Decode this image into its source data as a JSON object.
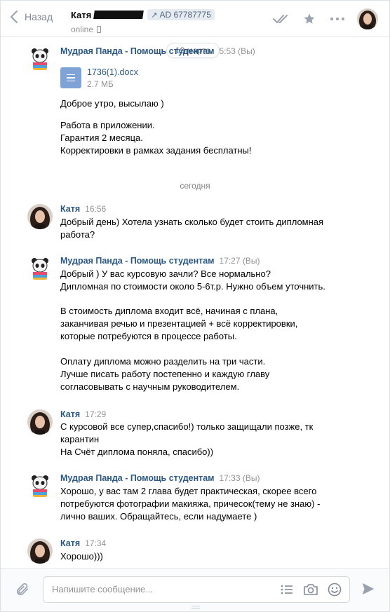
{
  "header": {
    "back_label": "Назад",
    "peer_name": "Катя",
    "ad_label": "AD 67787775",
    "status": "online"
  },
  "history": {
    "date_pill": "19 марта",
    "separator_today": "сегодня",
    "messages": [
      {
        "author": "Мудрая Панда - Помощь студентам",
        "time": "5:53 (Вы)",
        "doc_name": "1736(1).docx",
        "doc_size": "2.7 МБ",
        "text": "Доброе утро, высылаю )",
        "text2": "Работа в приложении.\nГарантия 2 месяца.\nКорректировки в рамках задания бесплатны!"
      },
      {
        "author": "Катя",
        "time": "16:56",
        "text": "Добрый день) Хотела узнать сколько будет стоить дипломная\nработа?"
      },
      {
        "author": "Мудрая Панда - Помощь студентам",
        "time": "17:27 (Вы)",
        "text": "Добрый ) У вас курсовую зачли? Все нормально?\nДипломная по стоимости около 5-6т.р. Нужно объем уточнить.",
        "text2": "В стоимость диплома входит всё, начиная с плана,\nзаканчивая речью и презентацией + всё корректировки,\nкоторые потребуются в процессе работы.",
        "text3": "Оплату диплома можно разделить на три части.\nЛучше писать работу постепенно и каждую главу\nсогласовывать с научным руководителем."
      },
      {
        "author": "Катя",
        "time": "17:29",
        "text": "С курсовой все супер,спасибо!) только защищали позже, тк\nкарантин\nНа Счёт диплома поняла, спасибо))"
      },
      {
        "author": "Мудрая Панда - Помощь студентам",
        "time": "17:33 (Вы)",
        "text": "Хорошо, у вас там 2 глава будет практическая, скорее всего\nпотребуются фотографии макияжа, причесок(тему не знаю) -\nлично ваших. Обращайтесь, если надумаете )"
      },
      {
        "author": "Катя",
        "time": "17:34",
        "text": "Хорошо)))"
      }
    ]
  },
  "composer": {
    "placeholder": "Напишите сообщение..."
  },
  "colors": {
    "link": "#2a5885",
    "muted": "#939393",
    "icon": "#99a2ad",
    "doc": "#7fa3d6"
  },
  "icons": [
    "chevron-left-icon",
    "phone-icon",
    "external-link-icon",
    "double-check-icon",
    "star-icon",
    "more-dots-icon",
    "paperclip-icon",
    "list-icon",
    "camera-icon",
    "smile-icon",
    "send-icon",
    "document-icon"
  ]
}
